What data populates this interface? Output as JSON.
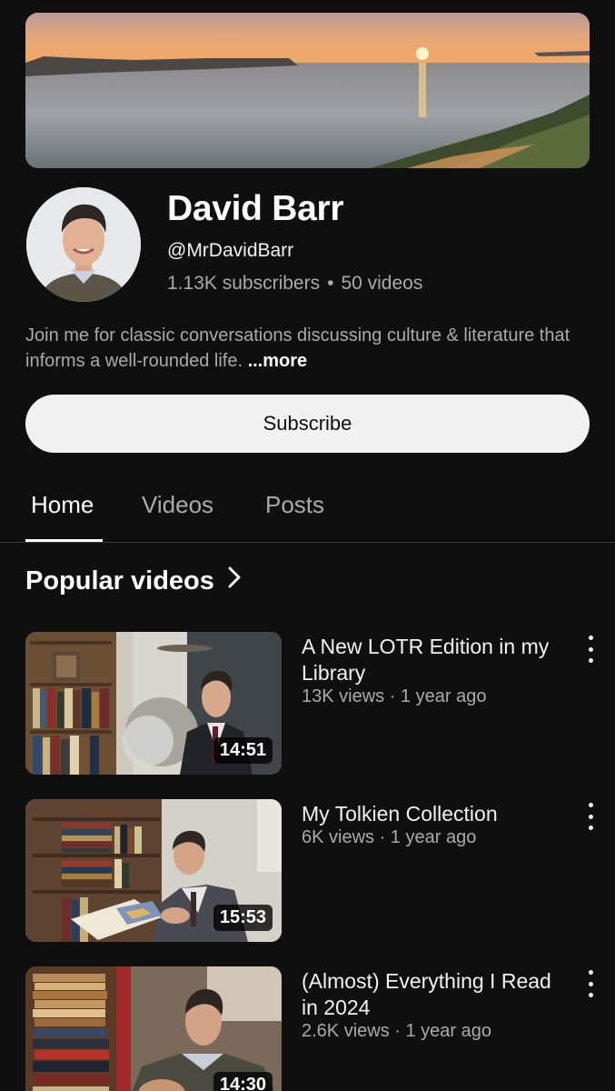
{
  "channel": {
    "name": "David Barr",
    "handle": "@MrDavidBarr",
    "subscribers": "1.13K subscribers",
    "separator": "•",
    "video_count": "50 videos",
    "description": "Join me for classic conversations discussing culture & literature that informs a well-rounded life.",
    "more_label": "...more"
  },
  "subscribe_label": "Subscribe",
  "tabs": [
    {
      "label": "Home",
      "active": true
    },
    {
      "label": "Videos",
      "active": false
    },
    {
      "label": "Posts",
      "active": false
    }
  ],
  "section": {
    "title": "Popular videos",
    "icon": "chevron-right-icon"
  },
  "videos": [
    {
      "title": "A New LOTR Edition in my Library",
      "meta": "13K views · 1 year ago",
      "duration": "14:51"
    },
    {
      "title": "My Tolkien Collection",
      "meta": "6K views · 1 year ago",
      "duration": "15:53"
    },
    {
      "title": "(Almost) Everything I Read in 2024",
      "meta": "2.6K views · 1 year ago",
      "duration": "14:30"
    }
  ],
  "colors": {
    "background": "#0f0f0f",
    "text_primary": "#f1f1f1",
    "text_secondary": "#aaaaaa",
    "subscribe_bg": "#f1f1f1"
  }
}
